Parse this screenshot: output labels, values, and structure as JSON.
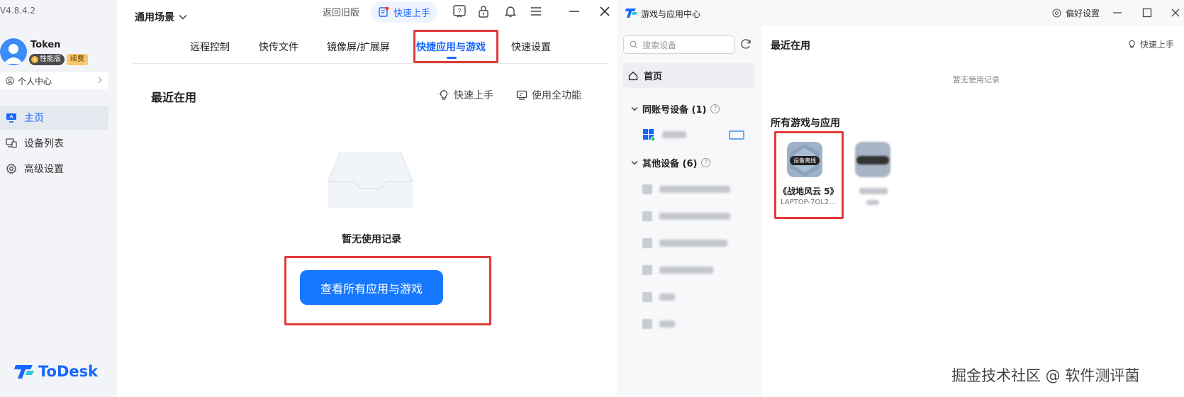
{
  "colors": {
    "accent": "#1666ff",
    "highlight_box": "#e23a3a",
    "button": "#1677ff"
  },
  "sidebar": {
    "version": "V4.8.4.2",
    "user": {
      "name": "Token",
      "badge_perf": "性能版",
      "badge_renew": "续费"
    },
    "personal_center": "个人中心",
    "items": [
      {
        "label": "主页",
        "icon": "home-monitor-icon",
        "active": true
      },
      {
        "label": "设备列表",
        "icon": "devices-icon",
        "active": false
      },
      {
        "label": "高级设置",
        "icon": "gear-icon",
        "active": false
      }
    ],
    "logo_text": "ToDesk"
  },
  "main": {
    "scene": "通用场景",
    "return_old": "返回旧版",
    "quick_start": "快速上手",
    "tabs": [
      {
        "label": "远程控制",
        "active": false
      },
      {
        "label": "快传文件",
        "active": false
      },
      {
        "label": "镜像屏/扩展屏",
        "active": false
      },
      {
        "label": "快捷应用与游戏",
        "active": true
      },
      {
        "label": "快速设置",
        "active": false
      }
    ],
    "recent_title": "最近在用",
    "quick_start_link": "快速上手",
    "use_all": "使用全功能",
    "empty_text": "暂无使用记录",
    "view_all_button": "查看所有应用与游戏"
  },
  "games_window": {
    "title": "游戏与应用中心",
    "preferences": "偏好设置",
    "search_placeholder": "搜索设备",
    "home": "首页",
    "group_same": "同账号设备 (1)",
    "group_other": "其他设备 (6)",
    "recent_title": "最近在用",
    "quick_start": "快速上手",
    "empty_text": "暂无使用记录",
    "all_title": "所有游戏与应用",
    "game1": {
      "name": "《战地风云 5》",
      "device": "LAPTOP-7OL2...",
      "status": "设备离线"
    }
  },
  "watermark": "掘金技术社区 @ 软件测评菌"
}
